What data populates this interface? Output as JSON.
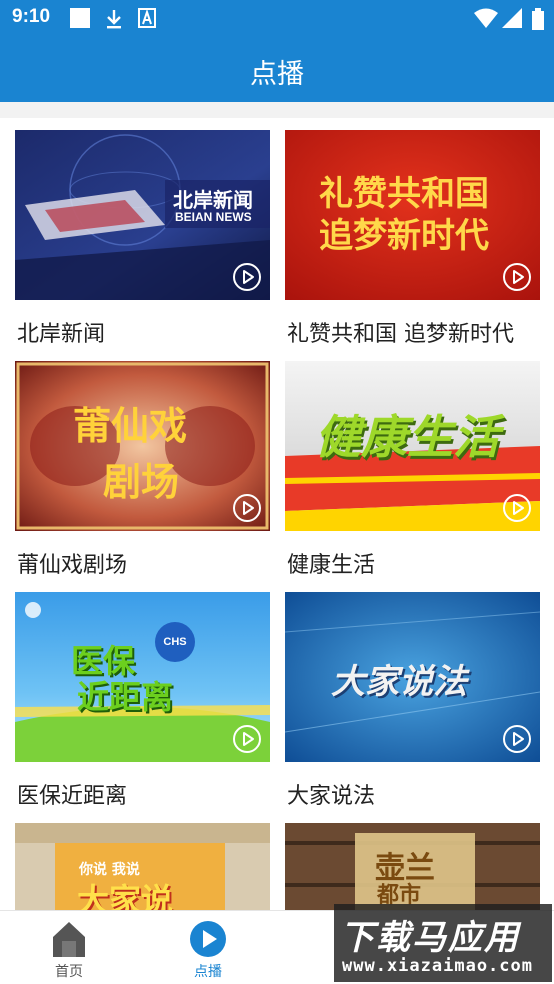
{
  "status_bar": {
    "time": "9:10",
    "icons": [
      "notification-square-icon",
      "download-icon",
      "font-a-icon",
      "wifi-icon",
      "signal-icon",
      "battery-icon"
    ]
  },
  "header": {
    "title": "点播"
  },
  "programs": [
    {
      "title": "北岸新闻",
      "thumb_text": "北岸新闻",
      "thumb_sub": "BEIAN NEWS"
    },
    {
      "title": "礼赞共和国 追梦新时代",
      "thumb_text": "礼赞共和国",
      "thumb_sub": "追梦新时代"
    },
    {
      "title": "莆仙戏剧场",
      "thumb_text": "莆仙戏",
      "thumb_sub": "剧场"
    },
    {
      "title": "健康生活",
      "thumb_text": "健康生活"
    },
    {
      "title": "医保近距离",
      "thumb_text": "医保",
      "thumb_sub": "近距离",
      "badge": "CHS"
    },
    {
      "title": "大家说法",
      "thumb_text": "大家说法"
    },
    {
      "title": "",
      "thumb_text": "大家说",
      "thumb_sub": "你说 我说"
    },
    {
      "title": "",
      "thumb_text": "壶兰",
      "thumb_sub": "都市"
    }
  ],
  "bottom_nav": [
    {
      "label": "首页",
      "icon": "home-icon",
      "active": false
    },
    {
      "label": "点播",
      "icon": "play-circle-icon",
      "active": true
    }
  ],
  "watermark": {
    "main": "下载马应用",
    "sub": "www.xiazaimao.com"
  },
  "colors": {
    "accent": "#1a84d1",
    "text": "#222222",
    "nav_inactive": "#555555"
  }
}
